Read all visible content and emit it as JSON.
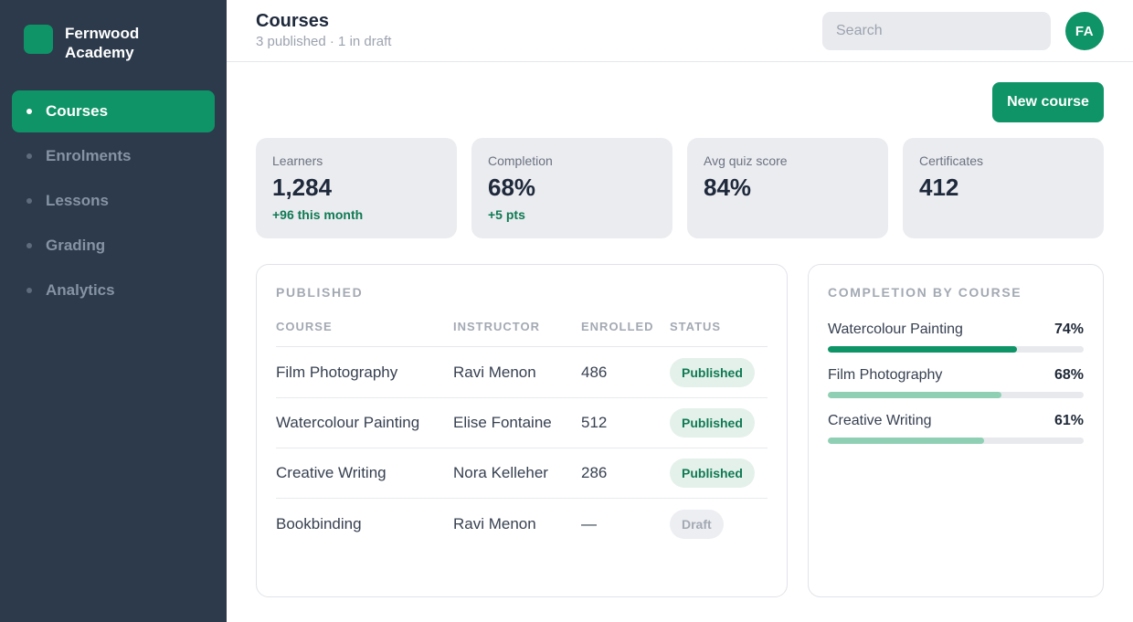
{
  "brand": {
    "name": "Fernwood Academy"
  },
  "sidebar": {
    "items": [
      {
        "label": "Courses",
        "active": true
      },
      {
        "label": "Enrolments",
        "active": false
      },
      {
        "label": "Lessons",
        "active": false
      },
      {
        "label": "Grading",
        "active": false
      },
      {
        "label": "Analytics",
        "active": false
      }
    ]
  },
  "header": {
    "title": "Courses",
    "subtitle": "3 published · 1 in draft",
    "search_placeholder": "Search",
    "avatar_initials": "FA"
  },
  "actions": {
    "new_course_label": "New course"
  },
  "stats": [
    {
      "label": "Learners",
      "value": "1,284",
      "delta": "+96 this month"
    },
    {
      "label": "Completion",
      "value": "68%",
      "delta": "+5 pts"
    },
    {
      "label": "Avg quiz score",
      "value": "84%",
      "delta": ""
    },
    {
      "label": "Certificates",
      "value": "412",
      "delta": ""
    }
  ],
  "published_panel": {
    "title": "PUBLISHED",
    "columns": [
      "COURSE",
      "INSTRUCTOR",
      "ENROLLED",
      "STATUS"
    ],
    "rows": [
      {
        "course": "Film Photography",
        "instructor": "Ravi Menon",
        "enrolled": "486",
        "status": "Published"
      },
      {
        "course": "Watercolour Painting",
        "instructor": "Elise Fontaine",
        "enrolled": "512",
        "status": "Published"
      },
      {
        "course": "Creative Writing",
        "instructor": "Nora Kelleher",
        "enrolled": "286",
        "status": "Published"
      },
      {
        "course": "Bookbinding",
        "instructor": "Ravi Menon",
        "enrolled": "—",
        "status": "Draft"
      }
    ]
  },
  "completion_panel": {
    "title": "COMPLETION BY COURSE",
    "items": [
      {
        "name": "Watercolour Painting",
        "pct_label": "74%",
        "value": 0.74,
        "color": "#0f9467"
      },
      {
        "name": "Film Photography",
        "pct_label": "68%",
        "value": 0.68,
        "color": "#8fd0b5"
      },
      {
        "name": "Creative Writing",
        "pct_label": "61%",
        "value": 0.61,
        "color": "#8fd0b5"
      }
    ]
  },
  "colors": {
    "accent": "#0f9467",
    "sidebar_bg": "#2c3a4b"
  }
}
